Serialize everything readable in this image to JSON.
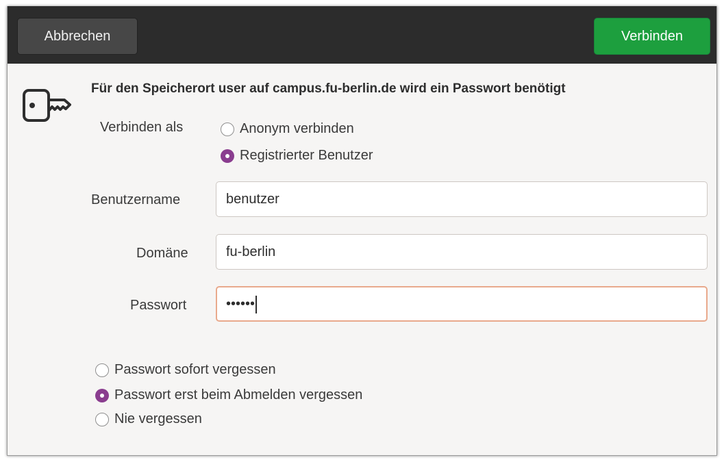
{
  "header": {
    "cancel_label": "Abbrechen",
    "connect_label": "Verbinden"
  },
  "message": "Für den Speicherort user auf campus.fu-berlin.de wird ein Passwort benötigt",
  "connect_as": {
    "label": "Verbinden als",
    "options": [
      {
        "label": "Anonym verbinden",
        "selected": false
      },
      {
        "label": "Registrierter Benutzer",
        "selected": true
      }
    ]
  },
  "fields": {
    "username": {
      "label": "Benutzername",
      "value": "benutzer"
    },
    "domain": {
      "label": "Domäne",
      "value": "fu-berlin"
    },
    "password": {
      "label": "Passwort",
      "value": "••••••"
    }
  },
  "remember": {
    "options": [
      {
        "label": "Passwort sofort vergessen",
        "selected": false
      },
      {
        "label": "Passwort erst beim Abmelden vergessen",
        "selected": true
      },
      {
        "label": "Nie vergessen",
        "selected": false
      }
    ]
  },
  "colors": {
    "accent": "#8a3d8f",
    "connect_button": "#1d9f3e",
    "header": "#2c2c2c",
    "focus_border": "#e9a98c"
  },
  "icons": {
    "dialog_icon": "key-icon"
  }
}
